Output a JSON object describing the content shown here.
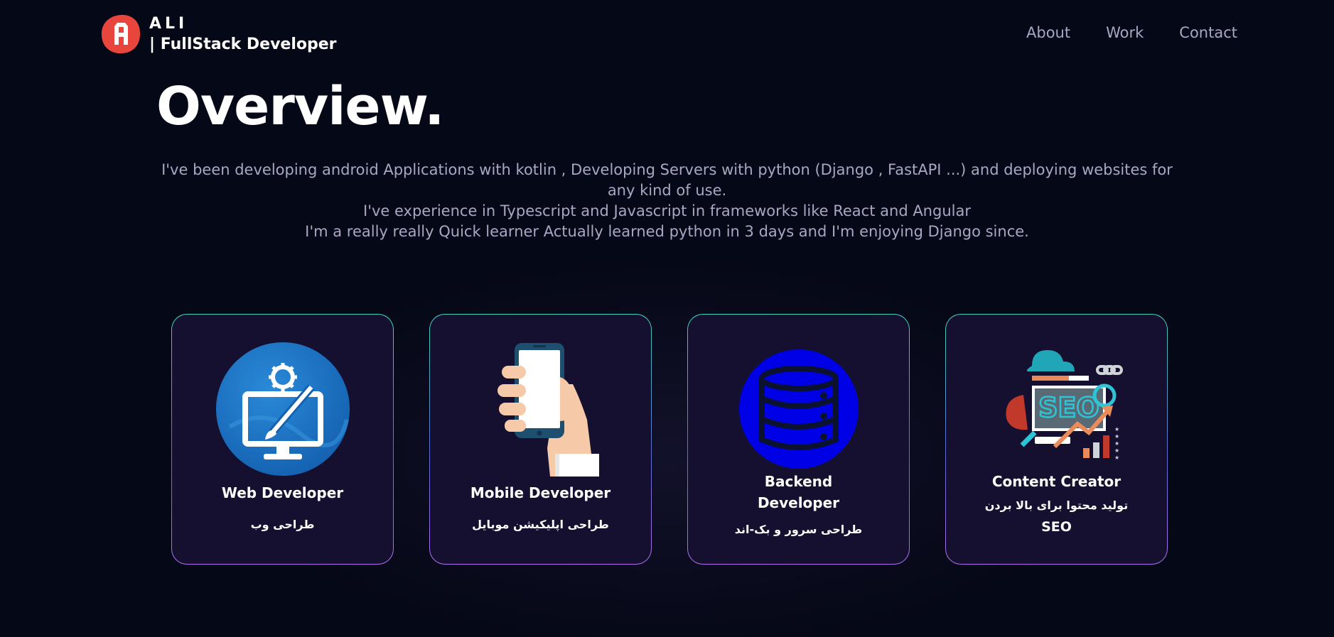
{
  "brand": {
    "name": "ALI",
    "role": "| FullStack Developer",
    "logo_letter": "A",
    "logo_color": "#e8453c"
  },
  "nav": {
    "links": [
      "About",
      "Work",
      "Contact"
    ]
  },
  "overview": {
    "title": "Overview.",
    "lines": [
      "I've been developing android Applications with kotlin , Developing Servers with python (Django , FastAPI ...) and deploying websites for any kind of use.",
      "I've experience in Typescript and Javascript in frameworks like React and Angular",
      "I'm a really really Quick learner Actually learned python in 3 days and I'm enjoying Django since."
    ]
  },
  "services": [
    {
      "title": "Web Developer",
      "subtitle": "طراحی وب",
      "icon": "web-developer-icon"
    },
    {
      "title": "Mobile Developer",
      "subtitle": "طراحی اپلیکیشن موبایل",
      "icon": "mobile-phone-icon"
    },
    {
      "title": "Backend Developer",
      "subtitle": "طراحی سرور و بک-اند",
      "icon": "database-icon"
    },
    {
      "title": "Content Creator",
      "subtitle": "تولید محتوا برای بالا بردن",
      "subtitle2": "SEO",
      "icon": "seo-icon"
    }
  ],
  "colors": {
    "background": "#050816",
    "card": "#151030",
    "muted_text": "#aaa6c3",
    "web_icon": "#1a73c7",
    "db_icon": "#0000e6"
  }
}
